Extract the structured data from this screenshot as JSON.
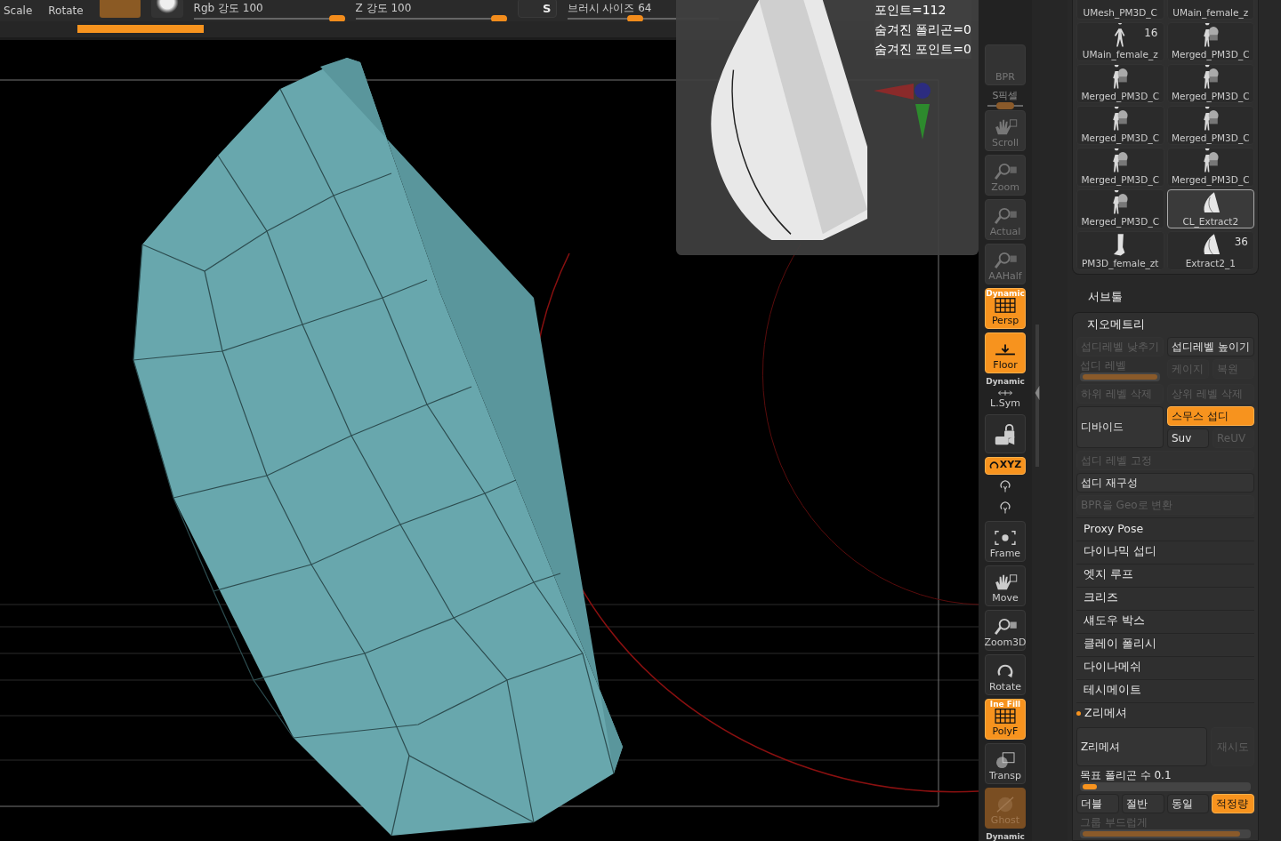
{
  "top_bar": {
    "labels": [
      "Scale",
      "Rotate"
    ],
    "sliders": [
      {
        "label": "Rgb 강도 100",
        "level": 0.95
      },
      {
        "label": "Z 강도 100",
        "level": 0.95
      },
      {
        "label": "브러시 사이즈 64",
        "level": 0.45
      }
    ],
    "symmetry_button": "S"
  },
  "stats": [
    "포인트=112",
    "숨겨진 폴리곤=0",
    "숨겨진 포인트=0"
  ],
  "toolbar": [
    {
      "kind": "button",
      "label": "BPR",
      "on": false,
      "disabled": true
    },
    {
      "kind": "slider",
      "label": "S픽셀",
      "level": 0.5
    },
    {
      "kind": "button",
      "label": "Scroll",
      "on": false,
      "disabled": true
    },
    {
      "kind": "button",
      "label": "Zoom",
      "on": false,
      "disabled": true
    },
    {
      "kind": "button",
      "label": "Actual",
      "on": false,
      "disabled": true
    },
    {
      "kind": "button",
      "label": "AAHalf",
      "on": false,
      "disabled": true
    },
    {
      "kind": "button",
      "label": "Persp",
      "on": true,
      "disabled": false,
      "top_label": "Dynamic"
    },
    {
      "kind": "button",
      "label": "Floor",
      "on": true,
      "disabled": false
    },
    {
      "kind": "small",
      "label": "L.Sym",
      "on": false,
      "disabled": false,
      "top_label": "Dynamic"
    },
    {
      "kind": "icon",
      "on": false,
      "disabled": false
    },
    {
      "kind": "pill",
      "label": "XYZ",
      "on": true,
      "disabled": false
    },
    {
      "kind": "tiny",
      "on": false,
      "disabled": false
    },
    {
      "kind": "tiny",
      "on": false,
      "disabled": false
    },
    {
      "kind": "button",
      "label": "Frame",
      "on": false,
      "disabled": false
    },
    {
      "kind": "button",
      "label": "Move",
      "on": false,
      "disabled": false
    },
    {
      "kind": "button",
      "label": "Zoom3D",
      "on": false,
      "disabled": false
    },
    {
      "kind": "button",
      "label": "Rotate",
      "on": false,
      "disabled": false
    },
    {
      "kind": "button",
      "label": "PolyF",
      "on": true,
      "disabled": false,
      "top_label": "Ine Fill"
    },
    {
      "kind": "button",
      "label": "Transp",
      "on": false,
      "disabled": false
    },
    {
      "kind": "button",
      "label": "Ghost",
      "on": true,
      "disabled": true
    },
    {
      "kind": "caption",
      "label": "Dynamic"
    }
  ],
  "subtools": [
    {
      "name": "UMesh_PM3D_C",
      "selected": false
    },
    {
      "name": "UMain_female_z",
      "selected": false
    },
    {
      "name": "UMain_female_z",
      "kind": "figure",
      "selected": false,
      "count": "16"
    },
    {
      "name": "Merged_PM3D_C",
      "kind": "group",
      "selected": false
    },
    {
      "name": "Merged_PM3D_C",
      "kind": "group",
      "selected": false
    },
    {
      "name": "Merged_PM3D_C",
      "kind": "group",
      "selected": false
    },
    {
      "name": "Merged_PM3D_C",
      "kind": "group",
      "selected": false
    },
    {
      "name": "Merged_PM3D_C",
      "kind": "group",
      "selected": false
    },
    {
      "name": "Merged_PM3D_C",
      "kind": "group",
      "selected": false
    },
    {
      "name": "Merged_PM3D_C",
      "kind": "group",
      "selected": false
    },
    {
      "name": "Merged_PM3D_C",
      "kind": "group",
      "selected": false
    },
    {
      "name": "CL_Extract2",
      "kind": "shell",
      "selected": true
    },
    {
      "name": "PM3D_female_zt",
      "kind": "leg",
      "selected": false
    },
    {
      "name": "Extract2_1",
      "kind": "shell",
      "selected": false,
      "count": "36"
    }
  ],
  "subtool_heading": "서브툴",
  "geometry": {
    "title": "지오메트리",
    "lower_subdiv": {
      "label": "섭디레벨 낮추기",
      "disabled": true,
      "on": false
    },
    "higher_subdiv": {
      "label": "섭디레벨 높이기",
      "disabled": false,
      "on": false
    },
    "subdiv_level": {
      "label": "섭디 레벨",
      "level": 1,
      "disabled": true
    },
    "cage": {
      "label": "케이지",
      "disabled": true,
      "on": false
    },
    "restore": {
      "label": "복원",
      "disabled": true,
      "on": false
    },
    "delete_lower": {
      "label": "하위 레벨 삭제",
      "disabled": true,
      "on": false
    },
    "delete_higher": {
      "label": "상위 레벨 삭제",
      "disabled": true,
      "on": false
    },
    "divide": {
      "label": "디바이드",
      "disabled": false,
      "on": false
    },
    "smooth_subdiv": {
      "label": "스무스 섭디",
      "on": true
    },
    "suv": {
      "label": "Suv",
      "disabled": false,
      "on": false
    },
    "reuv": {
      "label": "ReUV",
      "disabled": true,
      "on": false
    },
    "freeze": {
      "label": "섭디 레벨 고정",
      "disabled": true,
      "on": false
    },
    "reconstruct": {
      "label": "섭디 재구성",
      "disabled": false,
      "on": false
    },
    "convert_bpr": {
      "label": "BPR을 Geo로 변환",
      "disabled": true,
      "on": false
    }
  },
  "sections": [
    {
      "label": "Proxy Pose",
      "expanded": false
    },
    {
      "label": "다이나믹 섭디",
      "expanded": false
    },
    {
      "label": "엣지 루프",
      "expanded": false
    },
    {
      "label": "크리즈",
      "expanded": false
    },
    {
      "label": "섀도우 박스",
      "expanded": false
    },
    {
      "label": "클레이 폴리시",
      "expanded": false
    },
    {
      "label": "다이나메쉬",
      "expanded": false
    },
    {
      "label": "테시메이트",
      "expanded": false
    },
    {
      "label": "Z리메셔",
      "expanded": true
    }
  ],
  "zremesher": {
    "button": {
      "label": "Z리메셔",
      "disabled": false,
      "on": false
    },
    "redo": {
      "label": "재시도",
      "disabled": true,
      "on": false
    },
    "target": {
      "label": "목표 폴리곤 수 0.1",
      "level": 0.05,
      "disabled": false
    },
    "modes": [
      {
        "label": "더블",
        "selected": false
      },
      {
        "label": "절반",
        "selected": false
      },
      {
        "label": "동일",
        "selected": false
      },
      {
        "label": "적정량",
        "selected": true
      }
    ],
    "group_smooth": {
      "label": "그룹 부드럽게",
      "level": 0.95,
      "disabled": true
    }
  }
}
